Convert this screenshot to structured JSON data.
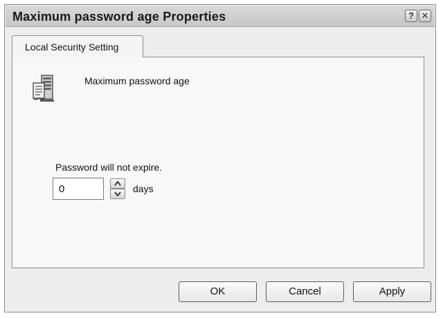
{
  "window": {
    "title": "Maximum password age Properties",
    "help_glyph": "?",
    "close_glyph": "✕"
  },
  "tabs": [
    {
      "label": "Local Security Setting",
      "active": true
    }
  ],
  "setting": {
    "icon": "policy-server-icon",
    "name": "Maximum password age"
  },
  "password_age": {
    "status_text": "Password will not expire.",
    "value": "0",
    "unit": "days"
  },
  "buttons": {
    "ok": "OK",
    "cancel": "Cancel",
    "apply": "Apply"
  }
}
